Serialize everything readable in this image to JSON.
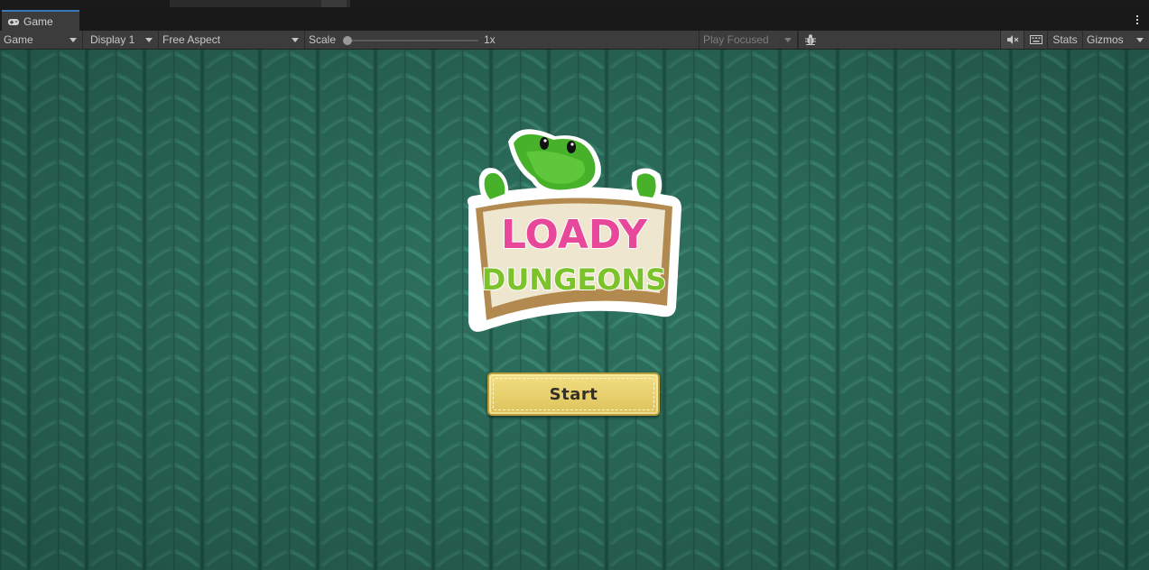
{
  "editor": {
    "tab": {
      "label": "Game",
      "icon": "gamepad-icon"
    },
    "toolbar": {
      "view_mode": "Game",
      "display": "Display 1",
      "aspect": "Free Aspect",
      "scale_label": "Scale",
      "scale_value": "1x",
      "play_mode": "Play Focused",
      "stats_label": "Stats",
      "gizmos_label": "Gizmos",
      "icons": [
        "bug-icon",
        "mute-audio-icon",
        "keyboard-icon",
        "kebab-menu-icon"
      ]
    },
    "colors": {
      "accent": "#3a79bb",
      "panel": "#3c3c3c",
      "background": "#191919"
    }
  },
  "game": {
    "logo": {
      "line1": "LOADY",
      "line2": "DUNGEONS"
    },
    "start_button": {
      "label": "Start"
    },
    "colors": {
      "background": "#2e7360",
      "logo_pink": "#e8489a",
      "logo_green": "#7cc22b",
      "button": "#e8d06c"
    }
  }
}
